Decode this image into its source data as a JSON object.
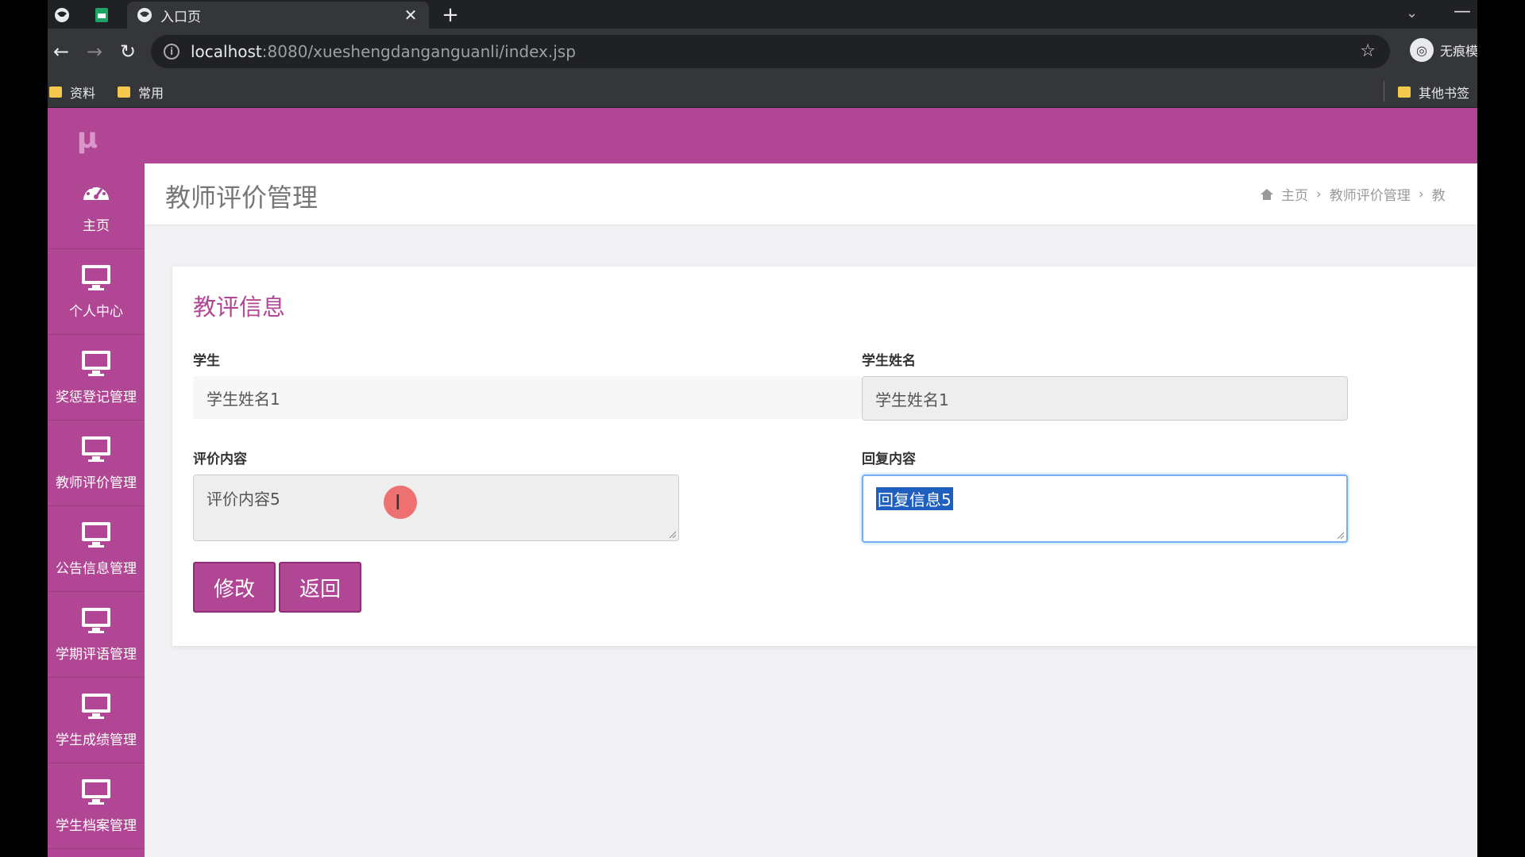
{
  "browser": {
    "tab_title": "入口页",
    "url_host": "localhost",
    "url_rest": ":8080/xueshengdanganguanli/index.jsp",
    "profile_label": "无痕模",
    "bookmarks": [
      "资料",
      "常用"
    ],
    "other_bookmarks": "其他书签"
  },
  "app": {
    "logo": "μ",
    "sidebar": [
      {
        "label": "主页",
        "icon": "dashboard-icon"
      },
      {
        "label": "个人中心",
        "icon": "monitor-icon"
      },
      {
        "label": "奖惩登记管理",
        "icon": "monitor-icon"
      },
      {
        "label": "教师评价管理",
        "icon": "monitor-icon"
      },
      {
        "label": "公告信息管理",
        "icon": "monitor-icon"
      },
      {
        "label": "学期评语管理",
        "icon": "monitor-icon"
      },
      {
        "label": "学生成绩管理",
        "icon": "monitor-icon"
      },
      {
        "label": "学生档案管理",
        "icon": "monitor-icon"
      }
    ],
    "page_title": "教师评价管理",
    "breadcrumb": [
      "主页",
      "教师评价管理",
      "教"
    ]
  },
  "form": {
    "heading": "教评信息",
    "student_label": "学生",
    "student_value": "学生姓名1",
    "student_name_label": "学生姓名",
    "student_name_value": "学生姓名1",
    "eval_label": "评价内容",
    "eval_value": "评价内容5",
    "reply_label": "回复内容",
    "reply_value": "回复信息5",
    "edit_button": "修改",
    "back_button": "返回"
  },
  "colors": {
    "brand": "#b14694",
    "focus": "#78aff0"
  }
}
